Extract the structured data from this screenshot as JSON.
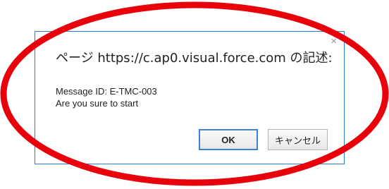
{
  "dialog": {
    "title": "ページ https://c.ap0.visual.force.com の記述:",
    "close_glyph": "×",
    "message_line1": "Message ID: E-TMC-003",
    "message_line2": "Are you sure to start",
    "ok_label": "OK",
    "cancel_label": "キャンセル"
  },
  "annotation": {
    "shape": "ellipse",
    "color": "#e8000b"
  }
}
